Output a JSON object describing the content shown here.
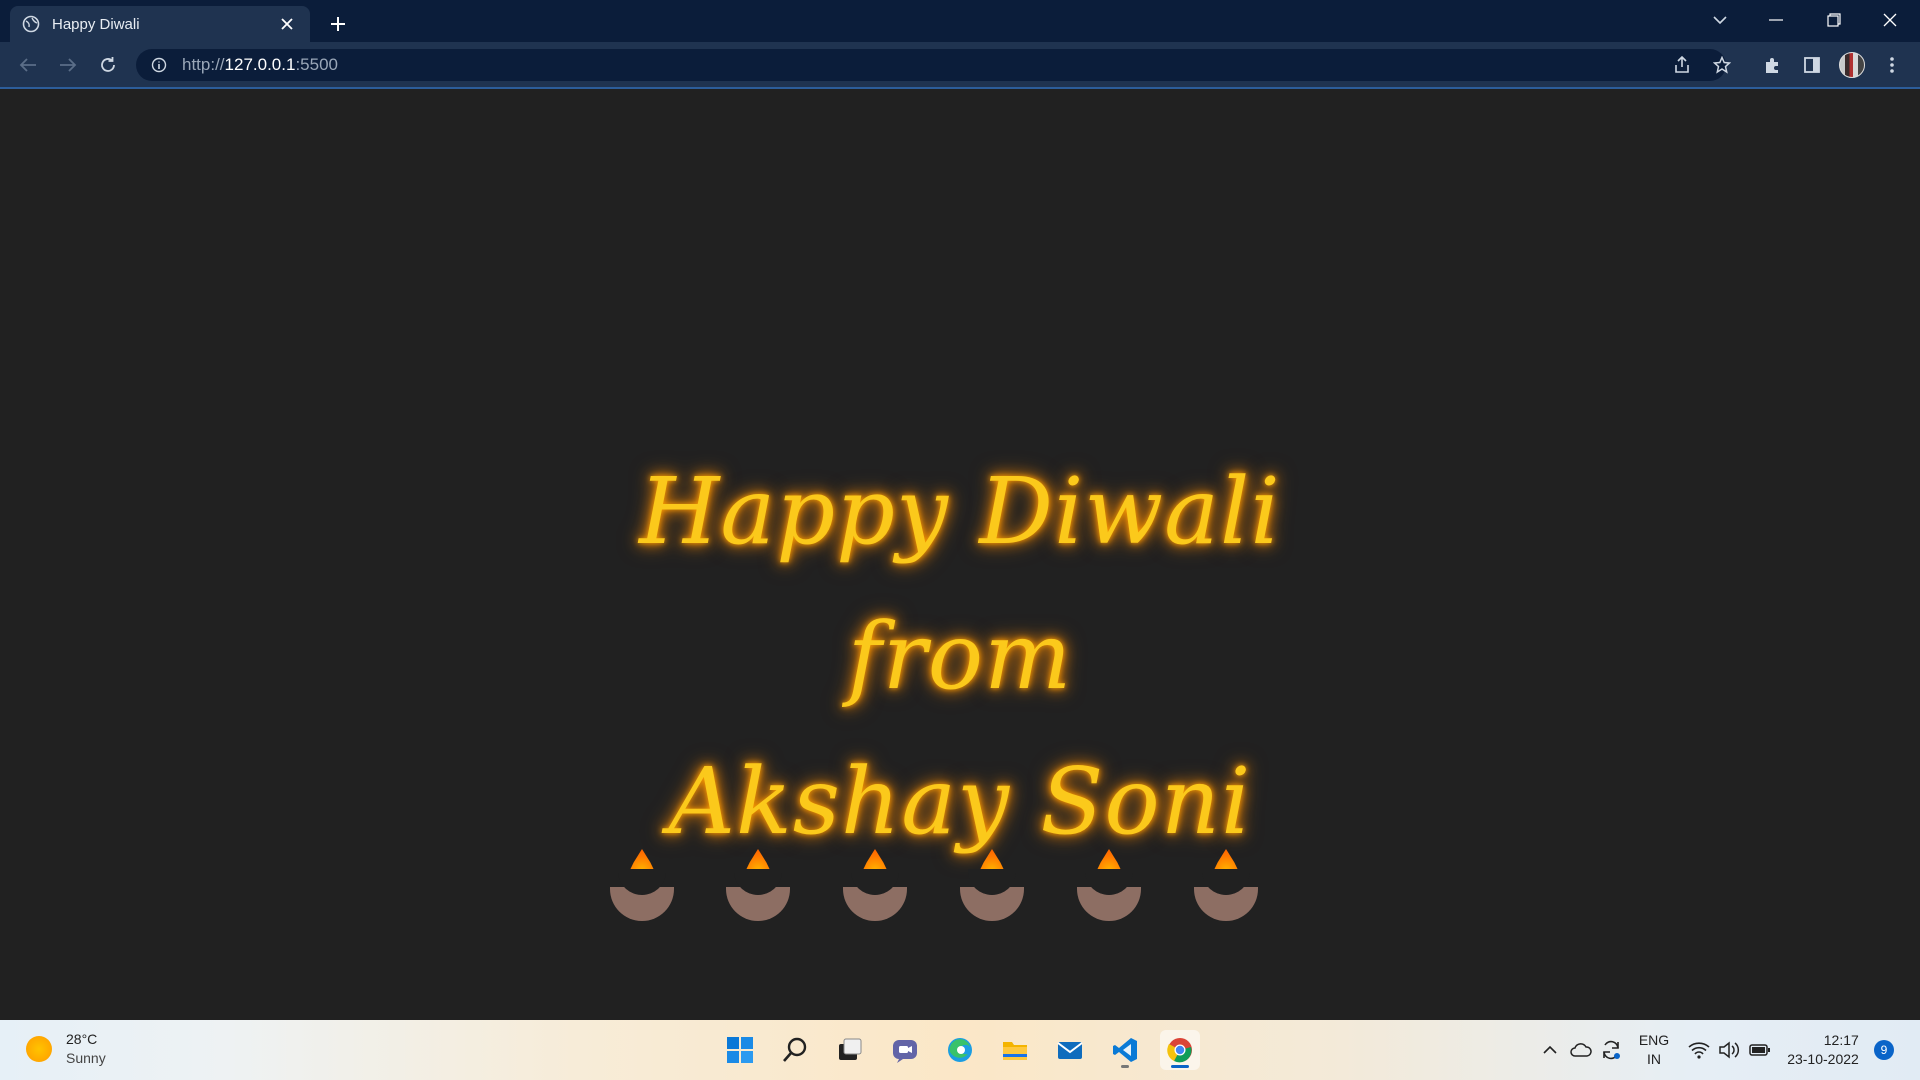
{
  "browser": {
    "tab_title": "Happy Diwali",
    "url_scheme": "http://",
    "url_host": "127.0.0.1",
    "url_port": ":5500"
  },
  "page": {
    "greeting_line1": "Happy Diwali from",
    "greeting_line2": "Akshay Soni",
    "text_color": "#fbc91b",
    "glow_color": "#ff8c00",
    "background": "#212121",
    "diyas": [
      "diya",
      "diya",
      "diya",
      "diya",
      "diya",
      "diya"
    ]
  },
  "taskbar": {
    "weather_temp": "28°C",
    "weather_condition": "Sunny",
    "apps": [
      "start",
      "search",
      "task-view",
      "teams-chat",
      "edge",
      "file-explorer",
      "mail",
      "vscode",
      "chrome"
    ],
    "language": "ENG",
    "region": "IN",
    "time": "12:17",
    "date": "23-10-2022",
    "notification_count": "9"
  }
}
